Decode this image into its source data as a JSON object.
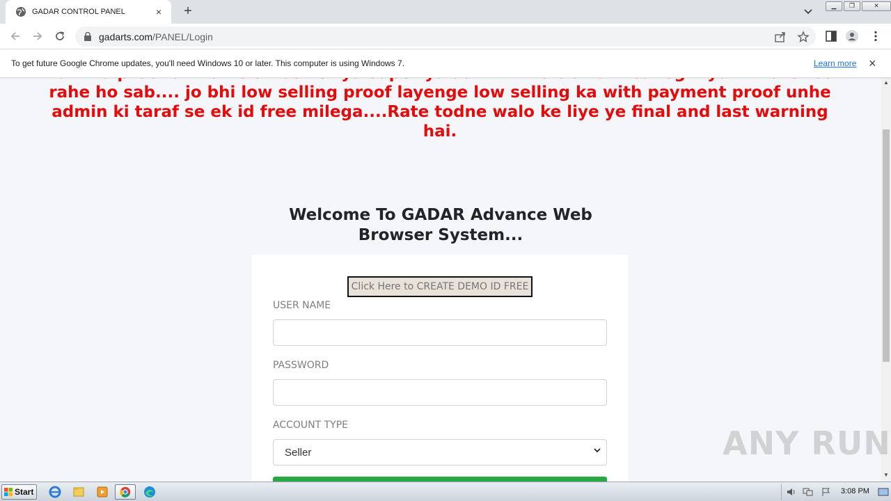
{
  "browser": {
    "tab_title": "GADAR CONTROL PANEL",
    "tab_close": "×",
    "new_tab": "+",
    "url_host": "gadarts.com",
    "url_path": "/PANEL/Login"
  },
  "infobar": {
    "message": "To get future Google Chrome updates, you'll need Windows 10 or later. This computer is using Windows 7.",
    "learn_more": "Learn more",
    "close": "×"
  },
  "page": {
    "marquee_text": "Kam ka proof dikha ke dil setter ya super ya admin ki id ab nahi banegi kyunki rate tod rahe ho sab.... jo bhi low selling proof layenge low selling ka with payment proof unhe admin ki taraf se ek id free milega....Rate todne walo ke liye ye final and last warning hai.",
    "welcome": "Welcome To GADAR Advance Web Browser System...",
    "demo_button": "Click Here to CREATE DEMO ID FREE",
    "username_label": "USER NAME",
    "username_value": "",
    "password_label": "PASSWORD",
    "password_value": "",
    "account_type_label": "ACCOUNT TYPE",
    "account_type_selected": "Seller"
  },
  "watermark": "ANY RUN",
  "taskbar": {
    "start": "Start",
    "clock": "3:08 PM"
  },
  "colors": {
    "marquee_red": "#e30b0b",
    "login_green": "#28a745",
    "link_blue": "#1a73e8"
  }
}
